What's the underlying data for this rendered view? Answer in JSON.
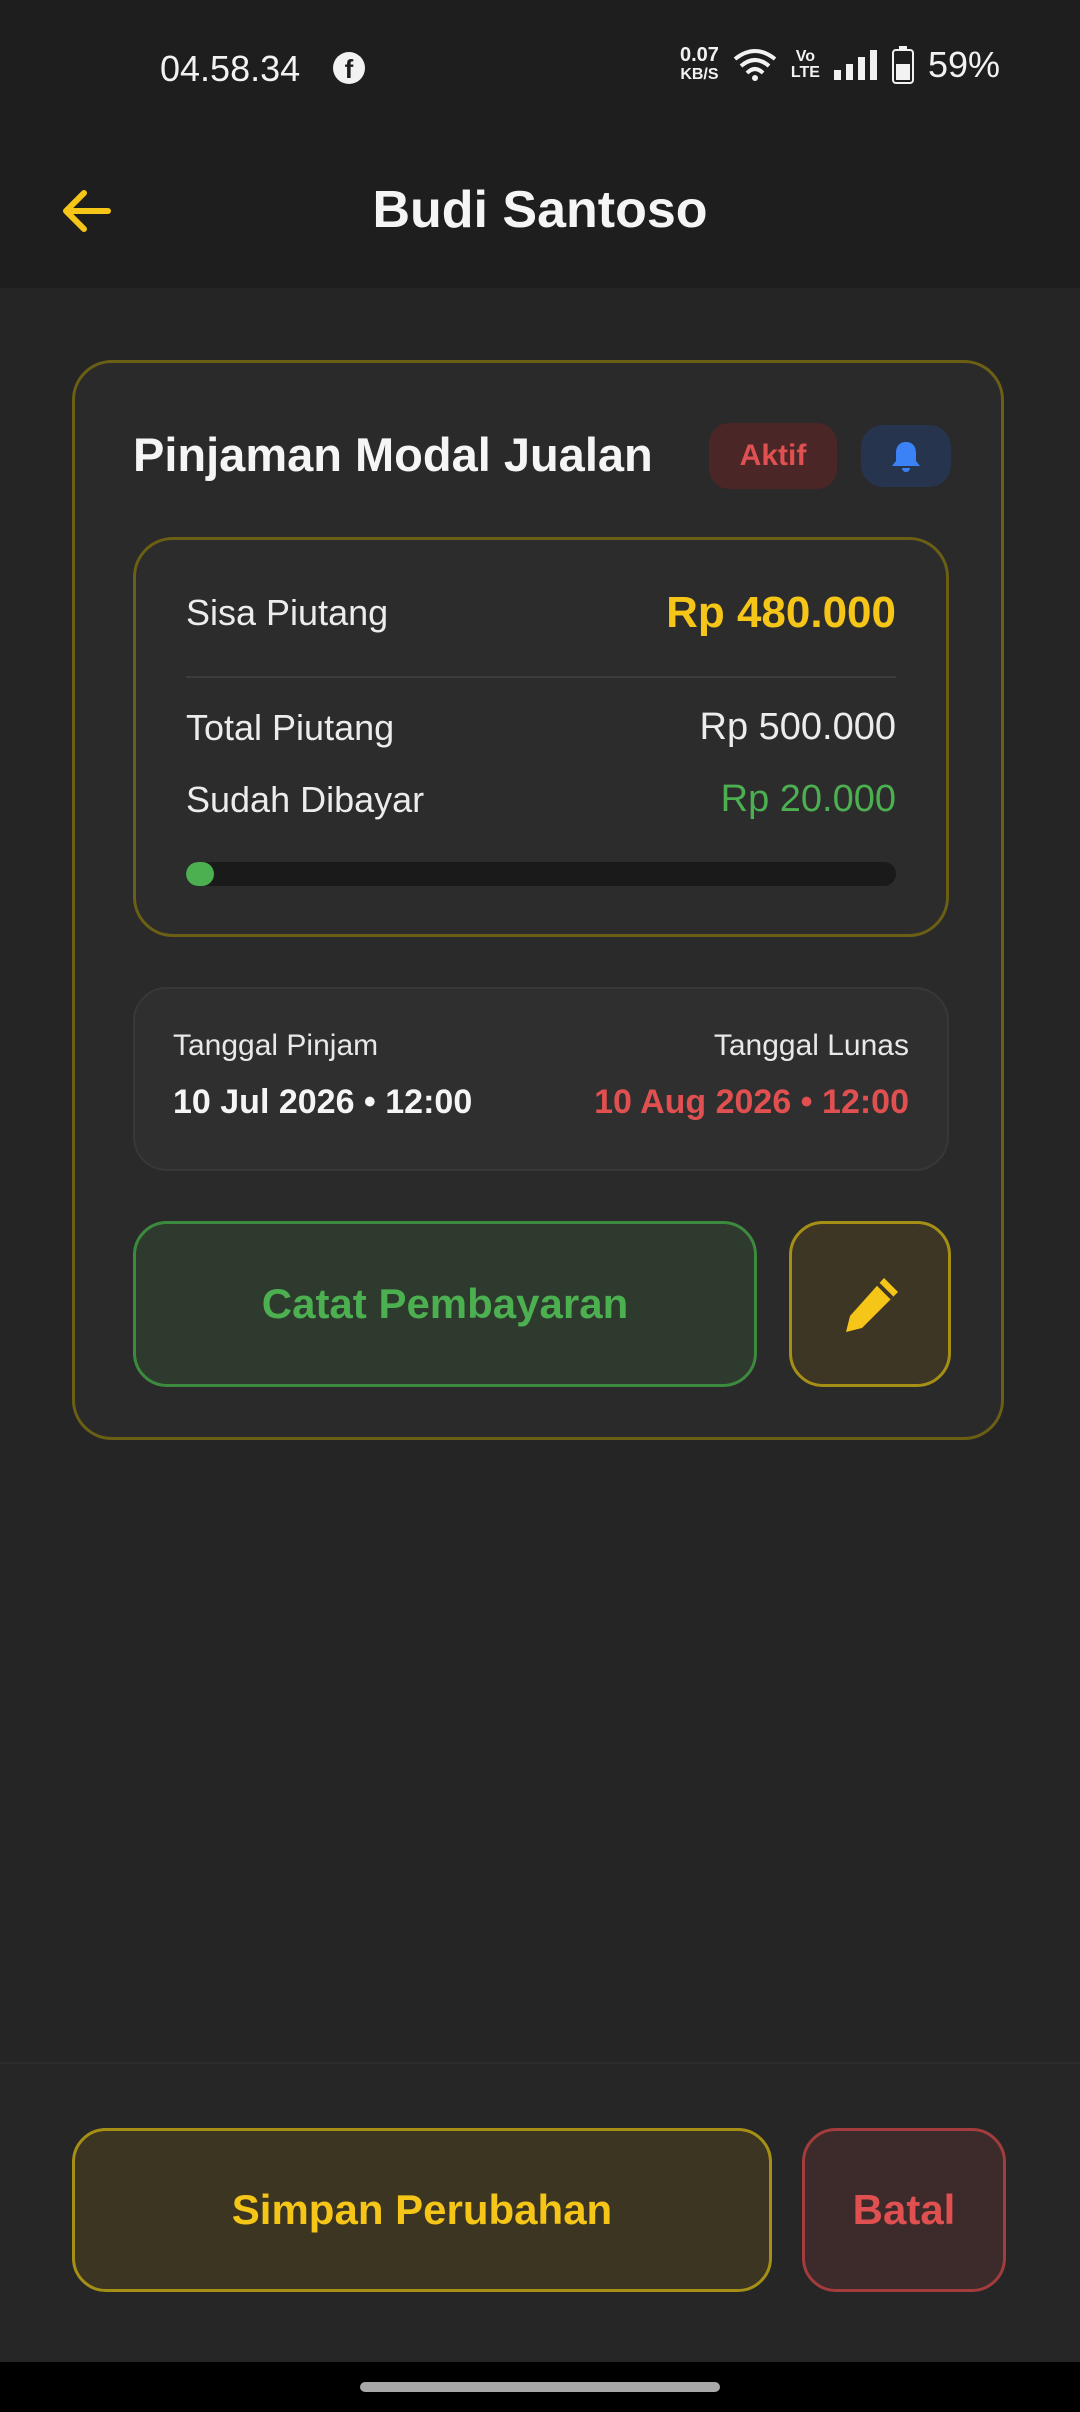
{
  "status_bar": {
    "time": "04.58.34",
    "facebook_icon": "f",
    "speed_value": "0.07",
    "speed_unit": "KB/S",
    "volte_top": "Vo",
    "volte_bottom": "LTE",
    "battery": "59%"
  },
  "appbar": {
    "title": "Budi Santoso"
  },
  "loan": {
    "title": "Pinjaman Modal Jualan",
    "status_badge": "Aktif",
    "remaining_label": "Sisa Piutang",
    "remaining_value": "Rp 480.000",
    "total_label": "Total Piutang",
    "total_value": "Rp 500.000",
    "paid_label": "Sudah Dibayar",
    "paid_value": "Rp 20.000",
    "progress_fraction": 0.04,
    "loan_date_label": "Tanggal Pinjam",
    "loan_date_value": "10 Jul 2026 • 12:00",
    "due_date_label": "Tanggal Lunas",
    "due_date_value": "10 Aug 2026 • 12:00",
    "record_payment_label": "Catat Pembayaran"
  },
  "footer": {
    "save_label": "Simpan Perubahan",
    "cancel_label": "Batal"
  },
  "colors": {
    "accent_yellow": "#f5c518",
    "green": "#4caf50",
    "red": "#e05050",
    "blue": "#3b82f6"
  },
  "icons": [
    "back-arrow-icon",
    "bell-icon",
    "pencil-icon",
    "facebook-icon",
    "wifi-icon",
    "signal-icon",
    "battery-icon"
  ]
}
